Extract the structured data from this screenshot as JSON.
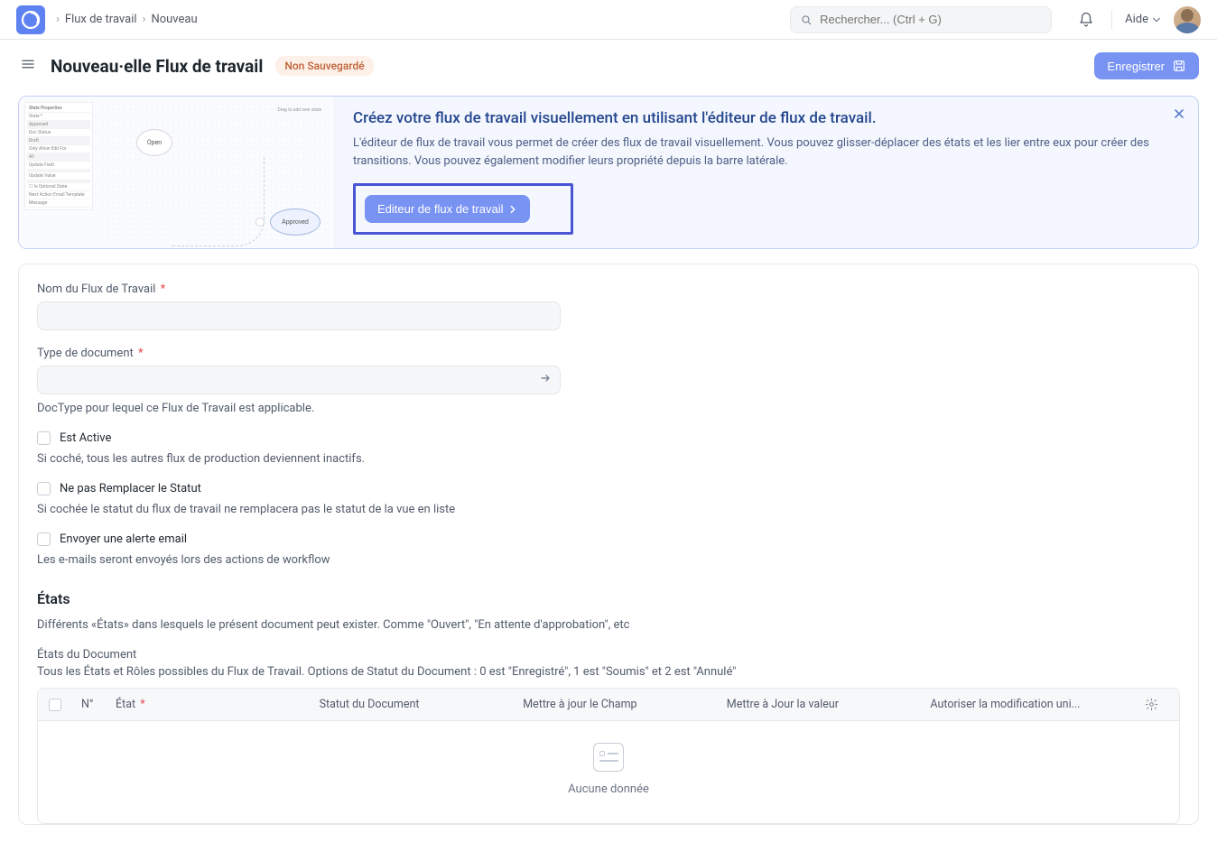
{
  "breadcrumb": {
    "item1": "Flux de travail",
    "item2": "Nouveau"
  },
  "search": {
    "placeholder": "Rechercher... (Ctrl + G)"
  },
  "topnav": {
    "help": "Aide"
  },
  "page": {
    "title": "Nouveau·elle Flux de travail",
    "status": "Non Sauvegardé",
    "save_btn": "Enregistrer"
  },
  "banner": {
    "title": "Créez votre flux de travail visuellement en utilisant l'éditeur de flux de travail.",
    "desc": "L'éditeur de flux de travail vous permet de créer des flux de travail visuellement. Vous pouvez glisser-déplacer des états et les lier entre eux pour créer des transitions. Vous pouvez également modifier leurs propriété depuis la barre latérale.",
    "btn": "Editeur de flux de travail",
    "mock": {
      "sidebar_title": "State Properties",
      "node_open": "Open",
      "node_approved": "Approved",
      "floating_label": "Drag to add new state"
    }
  },
  "form": {
    "name_label": "Nom du Flux de Travail",
    "doctype_label": "Type de document",
    "doctype_help": "DocType pour lequel ce Flux de Travail est applicable.",
    "active_label": "Est Active",
    "active_help": "Si coché, tous les autres flux de production deviennent inactifs.",
    "override_label": "Ne pas Remplacer le Statut",
    "override_help": "Si cochée le statut du flux de travail ne remplacera pas le statut de la vue en liste",
    "email_label": "Envoyer une alerte email",
    "email_help": "Les e-mails seront envoyés lors des actions de workflow"
  },
  "states": {
    "title": "États",
    "desc": "Différents «États» dans lesquels le présent document peut exister. Comme \"Ouvert\", \"En attente d'approbation\", etc",
    "sublabel": "États du Document",
    "subhelp": "Tous les États et Rôles possibles du Flux de Travail. Options de Statut du Document : 0 est \"Enregistré\", 1 est \"Soumis\" et 2 est \"Annulé\"",
    "headers": {
      "n": "N°",
      "state": "État",
      "status": "Statut du Document",
      "update_field": "Mettre à jour le Champ",
      "update_value": "Mettre à Jour la valeur",
      "allow_edit": "Autoriser la modification uni..."
    },
    "empty": "Aucune donnée"
  }
}
